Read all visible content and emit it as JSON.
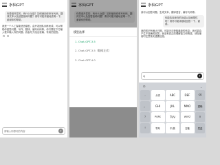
{
  "app_title": "水仙GPT",
  "panel1": {
    "user_message": "你是谁开发的，有什么功能？如何使用你来写代码、翻译文本以及回答各种问题？请尽可能详细地说明一下，谢谢你的帮助。",
    "assistant_message": "我是一个人工智能语言模型，由开发团队训练而成，可以帮助你回答问题、写作、翻译、编写代码等。你只需在下方输入框中输入你的问题，我会尽力给出准确、有用的回答。",
    "input_placeholder": "请输入你想问的内容"
  },
  "panel2": {
    "sheet_title": "模型选择",
    "models": [
      {
        "label": "Chat-GPT-3.5",
        "selected": true
      },
      {
        "label": "Chat-GPT-3.5（联网正式）",
        "selected": false
      },
      {
        "label": "Chat-GPT-4.0",
        "selected": false
      }
    ]
  },
  "panel3": {
    "user_message": "你能告诉我你的功能以及局限性吗？请尽可能详细地回答一下，谢谢。",
    "assistant_message_1": "我可以回答问题、生成文本、翻译语言、编写代码等。",
    "assistant_message_2": "我的知识有截止日期，可能无法获取最新的信息；我可能会产生不准确的回答；我没有真正的理解能力和情感。请在使用时注意核实重要信息。",
    "input_value": "4|",
    "keyboard": {
      "top_left": "中",
      "top_right": "⌄",
      "rows": [
        [
          ",",
          "分词",
          "ABC",
          "DEF",
          "⌫"
        ],
        [
          "。",
          "GHI",
          "JKL",
          "MNO",
          "重输"
        ],
        [
          "?",
          "PQRS",
          "TUV",
          "WXYZ",
          "0"
        ],
        [
          "!",
          "符号",
          "中/英",
          "空格",
          "发送"
        ]
      ]
    }
  },
  "colors": {
    "selected_model": "#1aa36a",
    "send_button": "#1f1f1f"
  }
}
